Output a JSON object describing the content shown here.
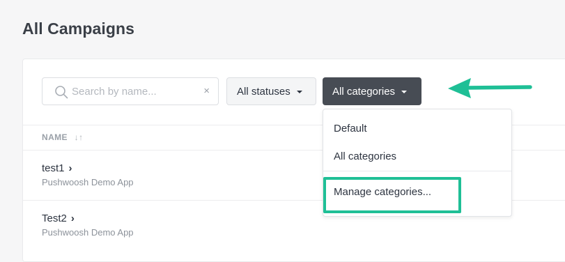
{
  "page": {
    "title": "All Campaigns"
  },
  "toolbar": {
    "search_placeholder": "Search by name...",
    "clear_symbol": "×",
    "status_filter_label": "All statuses",
    "category_filter_label": "All categories"
  },
  "table": {
    "header": {
      "name_label": "NAME",
      "sort_symbol": "↓↑"
    },
    "rows": [
      {
        "title": "test1",
        "chevron": "›",
        "subtitle": "Pushwoosh Demo App"
      },
      {
        "title": "Test2",
        "chevron": "›",
        "subtitle": "Pushwoosh Demo App"
      }
    ]
  },
  "dropdown": {
    "items": [
      {
        "label": "Default"
      },
      {
        "label": "All categories"
      },
      {
        "label": "Manage categories..."
      }
    ]
  },
  "annotations": {
    "accent_color": "#1fbf96",
    "arrow_icon": "arrow-left-icon"
  }
}
